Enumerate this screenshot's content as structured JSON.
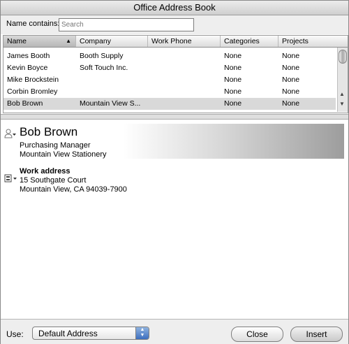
{
  "window": {
    "title": "Office Address Book"
  },
  "search": {
    "label": "Name contains:",
    "placeholder": "Search"
  },
  "list": {
    "columns": [
      "Name",
      "Company",
      "Work Phone",
      "Categories",
      "Projects"
    ],
    "rows": [
      {
        "name": "James Booth",
        "company": "Booth Supply",
        "phone": "",
        "categories": "None",
        "projects": "None"
      },
      {
        "name": "Kevin Boyce",
        "company": "Soft Touch Inc.",
        "phone": "",
        "categories": "None",
        "projects": "None"
      },
      {
        "name": "Mike Brockstein",
        "company": "",
        "phone": "",
        "categories": "None",
        "projects": "None"
      },
      {
        "name": "Corbin Bromley",
        "company": "",
        "phone": "",
        "categories": "None",
        "projects": "None"
      },
      {
        "name": "Bob Brown",
        "company": "Mountain View S...",
        "phone": "",
        "categories": "None",
        "projects": "None"
      }
    ]
  },
  "detail": {
    "name": "Bob Brown",
    "title": "Purchasing Manager",
    "company": "Mountain View Stationery",
    "address_label": "Work address",
    "street": "15 Southgate Court",
    "city_line": "Mountain View, CA 94039-7900"
  },
  "footer": {
    "use_label": "Use:",
    "use_value": "Default Address",
    "close_label": "Close",
    "insert_label": "Insert"
  }
}
